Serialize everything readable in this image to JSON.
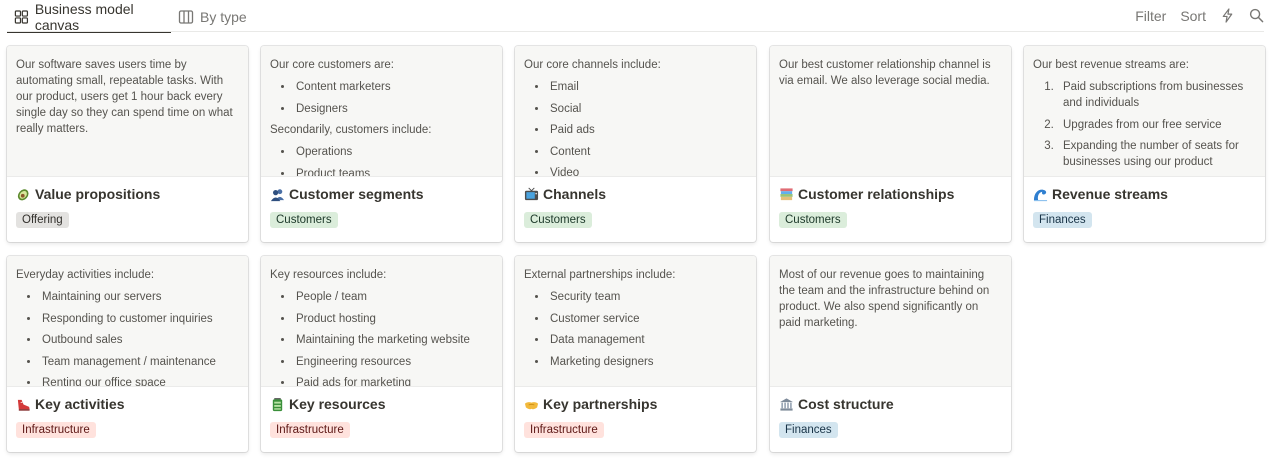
{
  "tabs": [
    {
      "label": "Business model canvas",
      "icon": "board-view-icon",
      "active": true
    },
    {
      "label": "By type",
      "icon": "table-columns-icon",
      "active": false
    }
  ],
  "toolbar": {
    "filter_label": "Filter",
    "sort_label": "Sort",
    "automation_icon": "lightning-icon",
    "search_icon": "search-icon"
  },
  "tag_colors": {
    "Offering": {
      "bg": "#e3e2e0",
      "fg": "#32302c"
    },
    "Customers": {
      "bg": "#dbeddb",
      "fg": "#1c3829"
    },
    "Finances": {
      "bg": "#d3e5ef",
      "fg": "#183347"
    },
    "Infrastructure": {
      "bg": "#ffe2dd",
      "fg": "#5d1715"
    }
  },
  "cards": [
    {
      "title": "Value propositions",
      "emoji": "avocado-icon",
      "tag": "Offering",
      "preview": [
        {
          "type": "p",
          "text": "Our software saves users time by automating small, repeatable tasks. With our product, users get 1 hour back every single day so they can spend time on what really matters."
        }
      ]
    },
    {
      "title": "Customer segments",
      "emoji": "people-icon",
      "tag": "Customers",
      "preview": [
        {
          "type": "p",
          "text": "Our core customers are:"
        },
        {
          "type": "ul",
          "items": [
            "Content marketers",
            "Designers"
          ]
        },
        {
          "type": "p",
          "text": "Secondarily, customers include:"
        },
        {
          "type": "ul",
          "items": [
            "Operations",
            "Product teams"
          ]
        }
      ]
    },
    {
      "title": "Channels",
      "emoji": "tv-icon",
      "tag": "Customers",
      "preview": [
        {
          "type": "p",
          "text": "Our core channels include:"
        },
        {
          "type": "ul",
          "items": [
            "Email",
            "Social",
            "Paid ads",
            "Content",
            "Video"
          ]
        }
      ]
    },
    {
      "title": "Customer relationships",
      "emoji": "books-icon",
      "tag": "Customers",
      "preview": [
        {
          "type": "p",
          "text": "Our best customer relationship channel is via email. We also leverage social media."
        }
      ]
    },
    {
      "title": "Revenue streams",
      "emoji": "wave-icon",
      "tag": "Finances",
      "preview": [
        {
          "type": "p",
          "text": "Our best revenue streams are:"
        },
        {
          "type": "ol",
          "items": [
            "Paid subscriptions from businesses and individuals",
            "Upgrades from our free service",
            "Expanding the number of seats for businesses using our product"
          ]
        }
      ]
    },
    {
      "title": "Key activities",
      "emoji": "shoe-icon",
      "tag": "Infrastructure",
      "preview": [
        {
          "type": "p",
          "text": "Everyday activities include:"
        },
        {
          "type": "ul",
          "items": [
            "Maintaining our servers",
            "Responding to customer inquiries",
            "Outbound sales",
            "Team management / maintenance",
            "Renting our office space"
          ]
        }
      ]
    },
    {
      "title": "Key resources",
      "emoji": "battery-icon",
      "tag": "Infrastructure",
      "preview": [
        {
          "type": "p",
          "text": "Key resources include:"
        },
        {
          "type": "ul",
          "items": [
            "People / team",
            "Product hosting",
            "Maintaining the marketing website",
            "Engineering resources",
            "Paid ads for marketing"
          ]
        }
      ]
    },
    {
      "title": "Key partnerships",
      "emoji": "handshake-icon",
      "tag": "Infrastructure",
      "preview": [
        {
          "type": "p",
          "text": "External partnerships include:"
        },
        {
          "type": "ul",
          "items": [
            "Security team",
            "Customer service",
            "Data management",
            "Marketing designers"
          ]
        }
      ]
    },
    {
      "title": "Cost structure",
      "emoji": "bank-icon",
      "tag": "Finances",
      "preview": [
        {
          "type": "p",
          "text": "Most of our revenue goes to maintaining the team and the infrastructure behind on product. We also spend significantly on paid marketing."
        }
      ]
    }
  ]
}
